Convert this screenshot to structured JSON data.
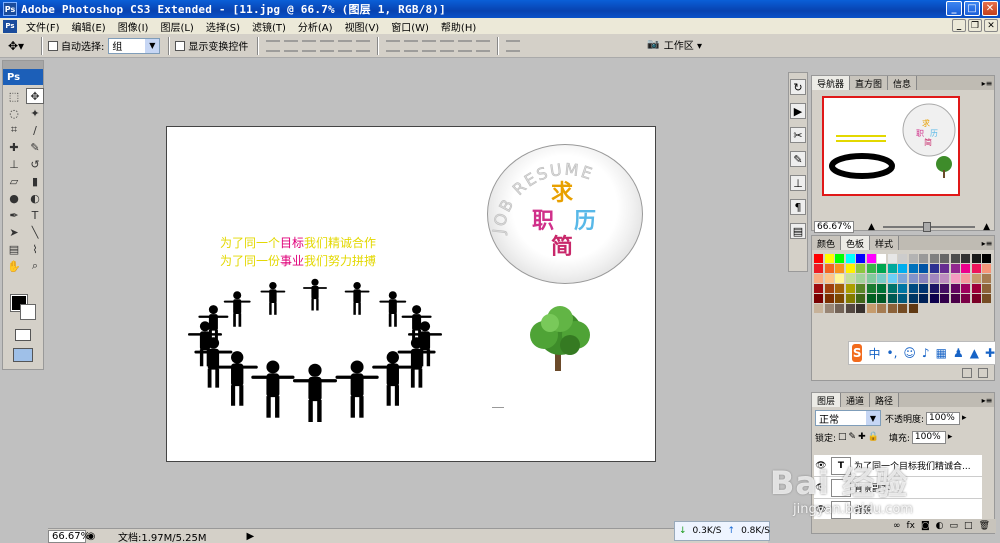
{
  "window": {
    "title": "Adobe Photoshop CS3 Extended - [11.jpg @ 66.7% (图层 1, RGB/8)]",
    "app_icon": "Ps"
  },
  "menubar": {
    "items": [
      "文件(F)",
      "编辑(E)",
      "图像(I)",
      "图层(L)",
      "选择(S)",
      "滤镜(T)",
      "分析(A)",
      "视图(V)",
      "窗口(W)",
      "帮助(H)"
    ]
  },
  "options": {
    "auto_select_label": "自动选择:",
    "auto_select_value": "组",
    "show_transform_label": "显示变换控件",
    "workspace_label": "工作区 ▾"
  },
  "toolbox": {
    "logo": "Ps",
    "tools": [
      "marquee-icon",
      "move-icon",
      "lasso-icon",
      "magic-wand-icon",
      "crop-icon",
      "slice-icon",
      "healing-icon",
      "brush-icon",
      "stamp-icon",
      "history-brush-icon",
      "eraser-icon",
      "gradient-icon",
      "blur-icon",
      "dodge-icon",
      "pen-icon",
      "type-icon",
      "path-select-icon",
      "line-icon",
      "notes-icon",
      "eyedropper-icon",
      "hand-icon",
      "zoom-icon"
    ],
    "colors": {
      "foreground": "#000000",
      "background": "#ffffff"
    }
  },
  "canvas": {
    "title_chars": [
      "求",
      "职",
      "历",
      "简"
    ],
    "title_colors": [
      "#e8a000",
      "#d0308a",
      "#58b8e8",
      "#c8286a"
    ],
    "ring_text": "JOB RESUME",
    "slogan_line1": [
      {
        "text": "为了同一个",
        "color": "#e3d800"
      },
      {
        "text": "目标",
        "color": "#e0007a"
      },
      {
        "text": "我们精诚合作",
        "color": "#e3d800"
      }
    ],
    "slogan_line2": [
      {
        "text": "为了同一份",
        "color": "#e3d800"
      },
      {
        "text": "事业",
        "color": "#e0007a"
      },
      {
        "text": "我们努力拼搏",
        "color": "#e3d800"
      }
    ]
  },
  "status": {
    "zoom": "66.67%",
    "doc_size": "文档:1.97M/5.25M",
    "net_down": "0.3K/S",
    "net_up": "0.8K/S"
  },
  "navigator": {
    "tabs": [
      "导航器",
      "直方图",
      "信息"
    ],
    "zoom": "66.67%"
  },
  "swatches": {
    "tabs": [
      "颜色",
      "色板",
      "样式"
    ]
  },
  "tray": {
    "lang": "中",
    "icons": [
      "punctuation-icon",
      "emoji-icon",
      "mic-icon",
      "keyboard-icon",
      "skin-icon",
      "shirt-icon",
      "tools-icon"
    ]
  },
  "layers": {
    "tabs": [
      "图层",
      "通道",
      "路径"
    ],
    "blend_mode": "正常",
    "opacity_label": "不透明度:",
    "opacity_value": "100%",
    "lock_label": "锁定:",
    "fill_label": "填充:",
    "fill_value": "100%",
    "items": [
      {
        "name": "为了同一个目标我们精诚合...",
        "thumb": "T"
      },
      {
        "name": "背景副本",
        "thumb": ""
      },
      {
        "name": "背景",
        "thumb": ""
      }
    ]
  },
  "watermark": {
    "brand": "Bai 经验",
    "url": "jingyan.baidu.com"
  }
}
